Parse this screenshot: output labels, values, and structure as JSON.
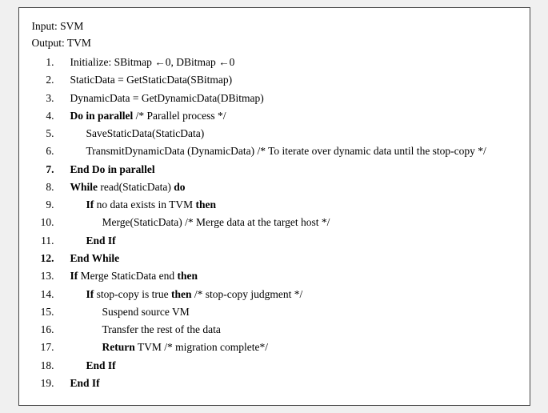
{
  "algorithm": {
    "input": "Input: SVM",
    "output": "Output: TVM",
    "lines": [
      {
        "num": "1.",
        "indent": 1,
        "bold_parts": [],
        "text": "Initialize: SBitmap ←0, DBitmap ←0"
      },
      {
        "num": "2.",
        "indent": 1,
        "bold_parts": [],
        "text": "StaticData = GetStaticData(SBitmap)"
      },
      {
        "num": "3.",
        "indent": 1,
        "bold_parts": [],
        "text": "DynamicData = GetDynamicData(DBitmap)"
      },
      {
        "num": "4.",
        "indent": 1,
        "bold_parts": [
          "Do in parallel"
        ],
        "text": "Do in parallel /* Parallel process */"
      },
      {
        "num": "5.",
        "indent": 2,
        "bold_parts": [],
        "text": "SaveStaticData(StaticData)"
      },
      {
        "num": "6.",
        "indent": 2,
        "bold_parts": [],
        "text": "TransmitDynamicData (DynamicData) /* To iterate over dynamic data until the stop-copy */"
      },
      {
        "num": "7.",
        "indent": 1,
        "bold_parts": [
          "End Do in parallel"
        ],
        "text": "End Do in parallel"
      },
      {
        "num": "8.",
        "indent": 1,
        "bold_parts": [
          "While"
        ],
        "text": "While read(StaticData) do"
      },
      {
        "num": "9.",
        "indent": 2,
        "bold_parts": [
          "If"
        ],
        "text": "If no data exists in TVM then"
      },
      {
        "num": "10.",
        "indent": 3,
        "bold_parts": [],
        "text": "Merge(StaticData) /* Merge data at the target host */"
      },
      {
        "num": "11.",
        "indent": 2,
        "bold_parts": [
          "End If"
        ],
        "text": "End If"
      },
      {
        "num": "12.",
        "indent": 1,
        "bold_parts": [
          "End While"
        ],
        "text": "End While"
      },
      {
        "num": "13.",
        "indent": 1,
        "bold_parts": [
          "If"
        ],
        "text": "If Merge StaticData end then"
      },
      {
        "num": "14.",
        "indent": 2,
        "bold_parts": [
          "If",
          "then"
        ],
        "text": "If stop-copy is true then /* stop-copy judgment */"
      },
      {
        "num": "15.",
        "indent": 3,
        "bold_parts": [],
        "text": "Suspend source VM"
      },
      {
        "num": "16.",
        "indent": 3,
        "bold_parts": [],
        "text": "Transfer the rest of the data"
      },
      {
        "num": "17.",
        "indent": 3,
        "bold_parts": [
          "Return"
        ],
        "text": "Return TVM /* migration complete*/"
      },
      {
        "num": "18.",
        "indent": 2,
        "bold_parts": [
          "End If"
        ],
        "text": "End If"
      },
      {
        "num": "19.",
        "indent": 1,
        "bold_parts": [
          "End If"
        ],
        "text": "End If"
      }
    ]
  }
}
